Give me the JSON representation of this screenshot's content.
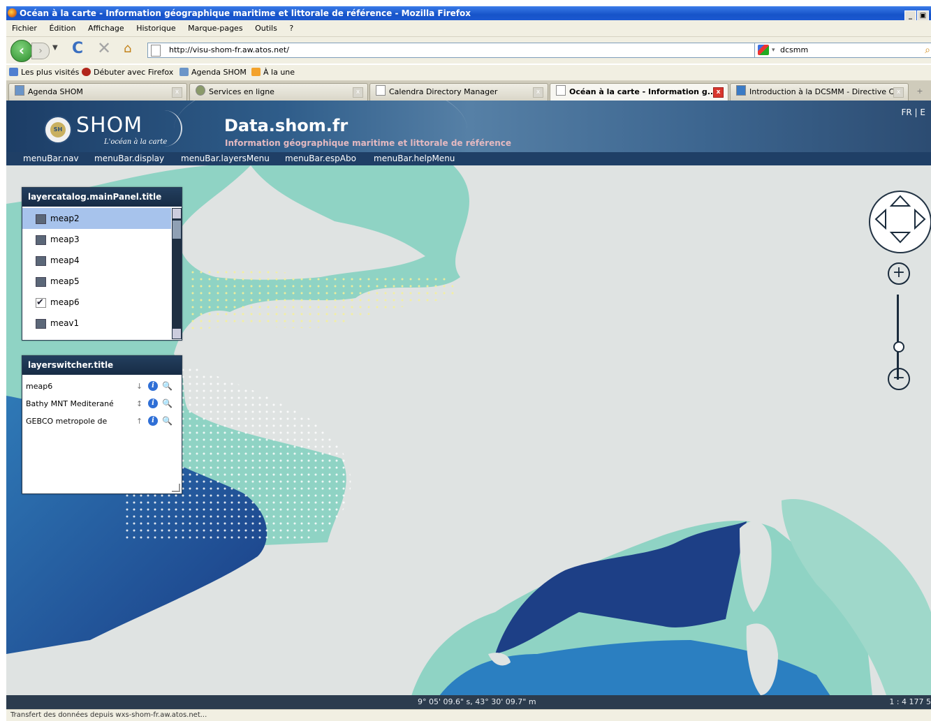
{
  "window": {
    "title": "Océan à la carte - Information géographique maritime et littorale de référence - Mozilla Firefox",
    "controls": [
      "_",
      "▣",
      "X"
    ]
  },
  "menu": [
    "Fichier",
    "Édition",
    "Affichage",
    "Historique",
    "Marque-pages",
    "Outils",
    "?"
  ],
  "nav": {
    "url": "http://visu-shom-fr.aw.atos.net/",
    "search_value": "dcsmm"
  },
  "bookmarks": [
    {
      "label": "Les plus visités",
      "icon": "folder-icon"
    },
    {
      "label": "Débuter avec Firefox",
      "icon": "firefox-icon"
    },
    {
      "label": "Agenda SHOM",
      "icon": "agenda-icon"
    },
    {
      "label": "À la une",
      "icon": "rss-icon"
    }
  ],
  "tabs": [
    {
      "label": "Agenda SHOM",
      "active": false
    },
    {
      "label": "Services en ligne",
      "active": false
    },
    {
      "label": "Calendra Directory Manager",
      "active": false
    },
    {
      "label": "Océan à la carte - Information g...",
      "active": true
    },
    {
      "label": "Introduction à la DCSMM - Directive C...",
      "active": false
    }
  ],
  "header": {
    "logo_text": "SHOM",
    "logo_tagline": "L'océan à la carte",
    "title": "Data.shom.fr",
    "subtitle": "Information géographique maritime et littorale de référence",
    "lang": "FR | E"
  },
  "app_menu": [
    "menuBar.nav",
    "menuBar.display",
    "menuBar.layersMenu",
    "menuBar.espAbo",
    "menuBar.helpMenu"
  ],
  "catalog": {
    "title": "layercatalog.mainPanel.title",
    "items": [
      {
        "label": "meap2",
        "checked": false,
        "selected": true
      },
      {
        "label": "meap3",
        "checked": false,
        "selected": false
      },
      {
        "label": "meap4",
        "checked": false,
        "selected": false
      },
      {
        "label": "meap5",
        "checked": false,
        "selected": false
      },
      {
        "label": "meap6",
        "checked": true,
        "selected": false
      },
      {
        "label": "meav1",
        "checked": false,
        "selected": false
      }
    ]
  },
  "switcher": {
    "title": "layerswitcher.title",
    "items": [
      {
        "label": "meap6",
        "arrows": "↓"
      },
      {
        "label": "Bathy MNT Mediterané",
        "arrows": "↕"
      },
      {
        "label": "GEBCO metropole de",
        "arrows": "↑"
      }
    ]
  },
  "map_status": {
    "coords": "9° 05' 09.6\" s,  43° 30' 09.7\" m",
    "scale": "1 : 4 177 5"
  },
  "status_bar": "Transfert des données depuis wxs-shom-fr.aw.atos.net...",
  "colors": {
    "header_dark": "#1c3d66",
    "panel_head": "#233e5e",
    "selection": "#a7c3ec",
    "land": "#dfe3e2",
    "shallow_sea": "#8fd3c4",
    "deep_sea": "#1d3f86"
  }
}
